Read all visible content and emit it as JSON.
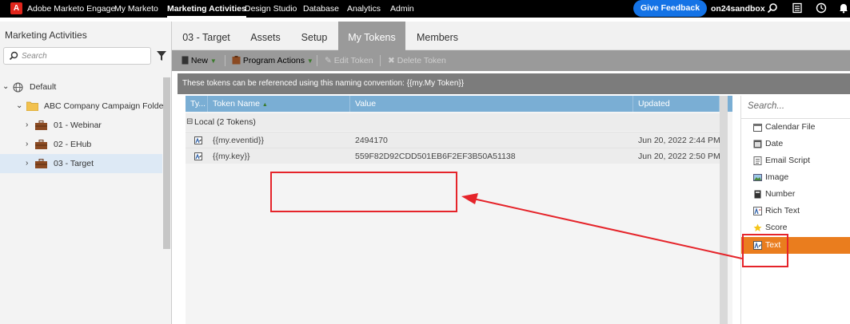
{
  "topnav": {
    "brand": "Adobe Marketo Engage",
    "items": [
      "My Marketo",
      "Marketing Activities",
      "Design Studio",
      "Database",
      "Analytics",
      "Admin"
    ],
    "active_item": "Marketing Activities",
    "feedback_label": "Give Feedback",
    "instance": "on24sandbox",
    "icons": [
      "search-icon",
      "grid-icon",
      "clock-icon",
      "bell-icon"
    ]
  },
  "left_panel": {
    "title": "Marketing Activities",
    "search_placeholder": "Search",
    "tree": [
      {
        "label": "Default",
        "icon": "globe-icon"
      },
      {
        "label": "ABC Company Campaign Folder",
        "icon": "folder-icon"
      },
      {
        "label": "01 - Webinar",
        "icon": "briefcase-icon"
      },
      {
        "label": "02 - EHub",
        "icon": "briefcase-icon"
      },
      {
        "label": "03 - Target",
        "icon": "briefcase-icon",
        "selected": true
      }
    ]
  },
  "tabs": [
    "03 - Target",
    "Assets",
    "Setup",
    "My Tokens",
    "Members"
  ],
  "active_tab": "My Tokens",
  "toolbar": {
    "new_label": "New",
    "program_actions_label": "Program Actions",
    "edit_token_label": "Edit Token",
    "delete_token_label": "Delete Token"
  },
  "info_text": "These tokens can be referenced using this naming convention: {{my.My Token}}",
  "grid": {
    "columns": [
      "Ty...",
      "Token Name",
      "Value",
      "Updated"
    ],
    "group_label": "Local (2 Tokens)",
    "rows": [
      {
        "name": "{{my.eventid}}",
        "value": "2494170",
        "updated": "Jun 20, 2022 2:44 PM"
      },
      {
        "name": "{{my.key}}",
        "value": "559F82D92CDD501EB6F2EF3B50A51138",
        "updated": "Jun 20, 2022 2:50 PM"
      }
    ]
  },
  "token_types": {
    "search_placeholder": "Search...",
    "items": [
      {
        "label": "Calendar File",
        "icon": "calendar-icon"
      },
      {
        "label": "Date",
        "icon": "date-icon"
      },
      {
        "label": "Email Script",
        "icon": "script-icon"
      },
      {
        "label": "Image",
        "icon": "image-icon"
      },
      {
        "label": "Number",
        "icon": "calculator-icon"
      },
      {
        "label": "Rich Text",
        "icon": "rich-text-icon"
      },
      {
        "label": "Score",
        "icon": "star-icon"
      },
      {
        "label": "Text",
        "icon": "text-icon",
        "selected": true
      }
    ]
  },
  "colors": {
    "annotation": "#e5242a",
    "selected_token_type": "#ea7d1e",
    "feedback_button": "#1473e6",
    "grid_header": "#7aaed4"
  }
}
